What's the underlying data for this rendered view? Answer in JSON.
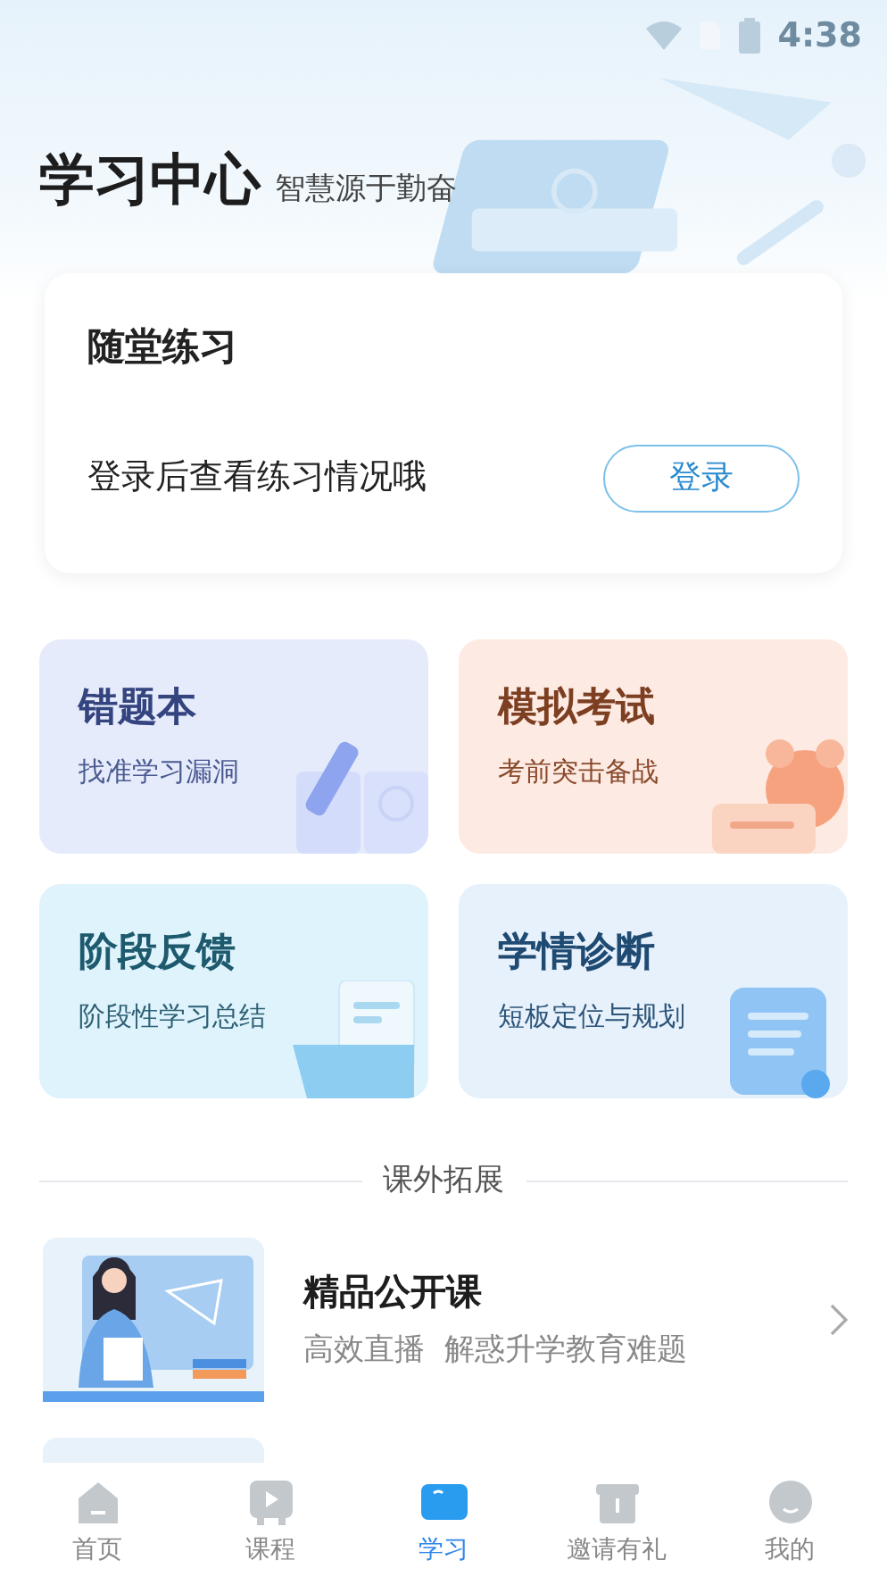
{
  "status_bar": {
    "time": "4:38"
  },
  "header": {
    "title": "学习中心",
    "slogan": "智慧源于勤奋"
  },
  "practice_card": {
    "title": "随堂练习",
    "message": "登录后查看练习情况哦",
    "button": "登录"
  },
  "tiles": [
    {
      "kind": "notebook",
      "title": "错题本",
      "subtitle": "找准学习漏洞"
    },
    {
      "kind": "clock",
      "title": "模拟考试",
      "subtitle": "考前突击备战"
    },
    {
      "kind": "folder",
      "title": "阶段反馈",
      "subtitle": "阶段性学习总结"
    },
    {
      "kind": "scroll",
      "title": "学情诊断",
      "subtitle": "短板定位与规划"
    }
  ],
  "section_title": "课外拓展",
  "courses": [
    {
      "title": "精品公开课",
      "subtitle": "高效直播  解惑升学教育难题"
    }
  ],
  "tab_bar": [
    {
      "kind": "home",
      "label": "首页",
      "selected": false
    },
    {
      "kind": "play",
      "label": "课程",
      "selected": false
    },
    {
      "kind": "book",
      "label": "学习",
      "selected": true
    },
    {
      "kind": "gift",
      "label": "邀请有礼",
      "selected": false
    },
    {
      "kind": "face",
      "label": "我的",
      "selected": false
    }
  ]
}
